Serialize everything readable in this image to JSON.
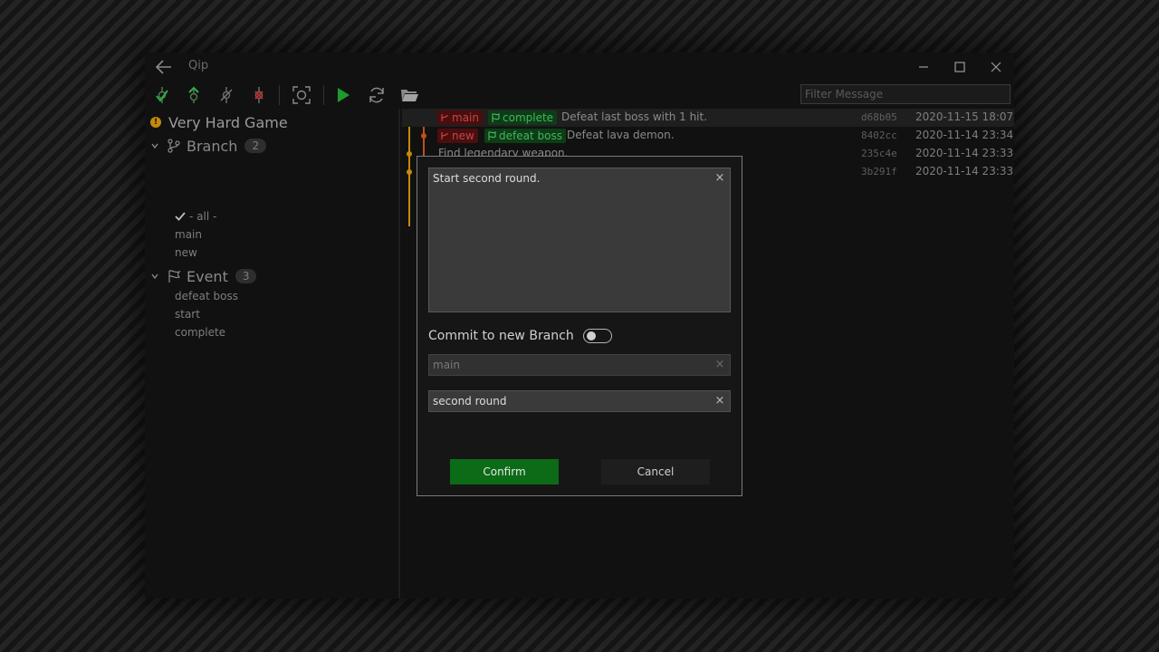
{
  "window": {
    "title": "Qip",
    "filter_placeholder": "Filter Message"
  },
  "sidebar": {
    "repo_name": "Very Hard Game",
    "branch_group": {
      "label": "Branch",
      "count": "2",
      "items": [
        "- all -",
        "main",
        "new"
      ]
    },
    "event_group": {
      "label": "Event",
      "count": "3",
      "items": [
        "defeat boss",
        "start",
        "complete"
      ]
    }
  },
  "commits": [
    {
      "branch_tag": "main",
      "event_tag": "complete",
      "message": "Defeat last boss with 1 hit.",
      "hash": "d68b05",
      "date": "2020-11-15 18:07"
    },
    {
      "branch_tag": "new",
      "event_tag": "defeat boss",
      "message": "Defeat lava demon.",
      "hash": "8402cc",
      "date": "2020-11-14 23:34"
    },
    {
      "message": "Find legendary weapon.",
      "hash": "235c4e",
      "date": "2020-11-14 23:33"
    },
    {
      "message": "",
      "hash": "3b291f",
      "date": "2020-11-14 23:33"
    }
  ],
  "dialog": {
    "commit_message": "Start second round.",
    "toggle_label": "Commit to new Branch",
    "branch_field": "main",
    "event_field": "second round",
    "confirm_label": "Confirm",
    "cancel_label": "Cancel",
    "clear_glyph": "×"
  },
  "colors": {
    "branch_tag_bg": "#4a0e0e",
    "event_tag_bg": "#0d3c17",
    "graph_line": "#c58a0c",
    "graph_branch_node": "#c0501a",
    "confirm_bg": "#0c6b16"
  }
}
